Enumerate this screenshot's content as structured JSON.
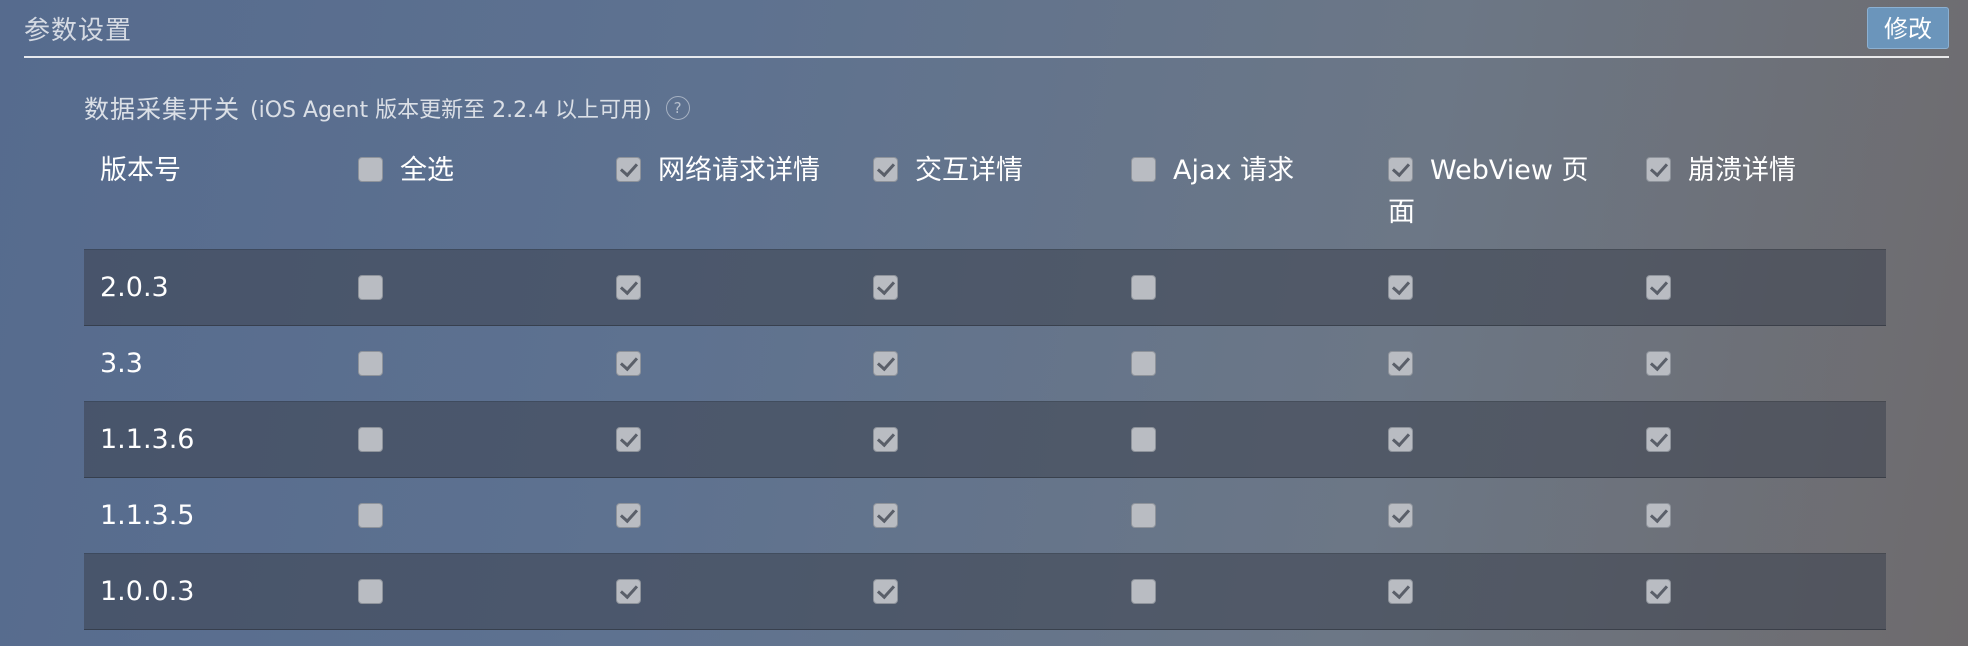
{
  "header": {
    "title": "参数设置",
    "edit_label": "修改"
  },
  "section": {
    "title": "数据采集开关",
    "subtitle": "(iOS Agent 版本更新至 2.2.4 以上可用)",
    "help_icon": "?"
  },
  "table": {
    "columns": [
      {
        "label": "版本号",
        "has_checkbox": false,
        "checked": false
      },
      {
        "label": "全选",
        "has_checkbox": true,
        "checked": false
      },
      {
        "label": "网络请求详情",
        "has_checkbox": true,
        "checked": true
      },
      {
        "label": "交互详情",
        "has_checkbox": true,
        "checked": true
      },
      {
        "label": "Ajax 请求",
        "has_checkbox": true,
        "checked": false
      },
      {
        "label": "WebView 页面",
        "has_checkbox": true,
        "checked": true
      },
      {
        "label": "崩溃详情",
        "has_checkbox": true,
        "checked": true
      }
    ],
    "rows": [
      {
        "version": "2.0.3",
        "checks": [
          false,
          true,
          true,
          false,
          true,
          true
        ]
      },
      {
        "version": "3.3",
        "checks": [
          false,
          true,
          true,
          false,
          true,
          true
        ]
      },
      {
        "version": "1.1.3.6",
        "checks": [
          false,
          true,
          true,
          false,
          true,
          true
        ]
      },
      {
        "version": "1.1.3.5",
        "checks": [
          false,
          true,
          true,
          false,
          true,
          true
        ]
      },
      {
        "version": "1.0.0.3",
        "checks": [
          false,
          true,
          true,
          false,
          true,
          true
        ]
      }
    ]
  },
  "colors": {
    "button_bg": "#6b95bb",
    "checkbox_bg": "#b9bcc2",
    "row_dark": "#4f5666"
  }
}
